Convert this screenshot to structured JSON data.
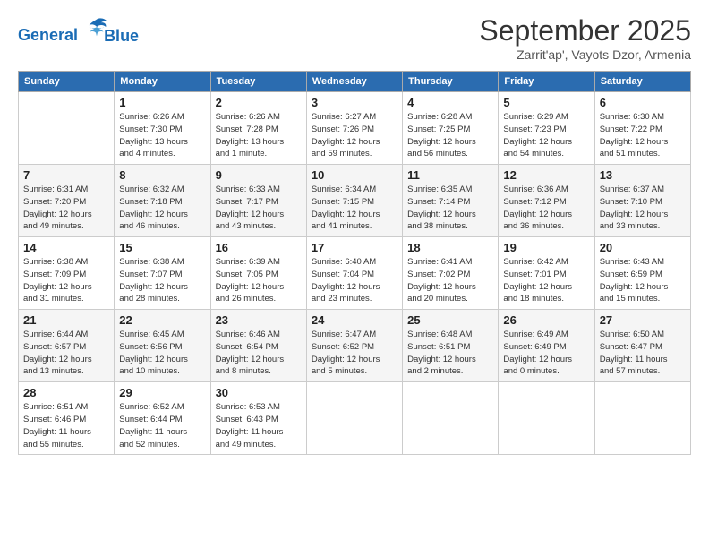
{
  "logo": {
    "line1": "General",
    "line2": "Blue"
  },
  "title": "September 2025",
  "subtitle": "Zarrit'ap', Vayots Dzor, Armenia",
  "days_of_week": [
    "Sunday",
    "Monday",
    "Tuesday",
    "Wednesday",
    "Thursday",
    "Friday",
    "Saturday"
  ],
  "weeks": [
    [
      {
        "day": "",
        "info": ""
      },
      {
        "day": "1",
        "info": "Sunrise: 6:26 AM\nSunset: 7:30 PM\nDaylight: 13 hours\nand 4 minutes."
      },
      {
        "day": "2",
        "info": "Sunrise: 6:26 AM\nSunset: 7:28 PM\nDaylight: 13 hours\nand 1 minute."
      },
      {
        "day": "3",
        "info": "Sunrise: 6:27 AM\nSunset: 7:26 PM\nDaylight: 12 hours\nand 59 minutes."
      },
      {
        "day": "4",
        "info": "Sunrise: 6:28 AM\nSunset: 7:25 PM\nDaylight: 12 hours\nand 56 minutes."
      },
      {
        "day": "5",
        "info": "Sunrise: 6:29 AM\nSunset: 7:23 PM\nDaylight: 12 hours\nand 54 minutes."
      },
      {
        "day": "6",
        "info": "Sunrise: 6:30 AM\nSunset: 7:22 PM\nDaylight: 12 hours\nand 51 minutes."
      }
    ],
    [
      {
        "day": "7",
        "info": "Sunrise: 6:31 AM\nSunset: 7:20 PM\nDaylight: 12 hours\nand 49 minutes."
      },
      {
        "day": "8",
        "info": "Sunrise: 6:32 AM\nSunset: 7:18 PM\nDaylight: 12 hours\nand 46 minutes."
      },
      {
        "day": "9",
        "info": "Sunrise: 6:33 AM\nSunset: 7:17 PM\nDaylight: 12 hours\nand 43 minutes."
      },
      {
        "day": "10",
        "info": "Sunrise: 6:34 AM\nSunset: 7:15 PM\nDaylight: 12 hours\nand 41 minutes."
      },
      {
        "day": "11",
        "info": "Sunrise: 6:35 AM\nSunset: 7:14 PM\nDaylight: 12 hours\nand 38 minutes."
      },
      {
        "day": "12",
        "info": "Sunrise: 6:36 AM\nSunset: 7:12 PM\nDaylight: 12 hours\nand 36 minutes."
      },
      {
        "day": "13",
        "info": "Sunrise: 6:37 AM\nSunset: 7:10 PM\nDaylight: 12 hours\nand 33 minutes."
      }
    ],
    [
      {
        "day": "14",
        "info": "Sunrise: 6:38 AM\nSunset: 7:09 PM\nDaylight: 12 hours\nand 31 minutes."
      },
      {
        "day": "15",
        "info": "Sunrise: 6:38 AM\nSunset: 7:07 PM\nDaylight: 12 hours\nand 28 minutes."
      },
      {
        "day": "16",
        "info": "Sunrise: 6:39 AM\nSunset: 7:05 PM\nDaylight: 12 hours\nand 26 minutes."
      },
      {
        "day": "17",
        "info": "Sunrise: 6:40 AM\nSunset: 7:04 PM\nDaylight: 12 hours\nand 23 minutes."
      },
      {
        "day": "18",
        "info": "Sunrise: 6:41 AM\nSunset: 7:02 PM\nDaylight: 12 hours\nand 20 minutes."
      },
      {
        "day": "19",
        "info": "Sunrise: 6:42 AM\nSunset: 7:01 PM\nDaylight: 12 hours\nand 18 minutes."
      },
      {
        "day": "20",
        "info": "Sunrise: 6:43 AM\nSunset: 6:59 PM\nDaylight: 12 hours\nand 15 minutes."
      }
    ],
    [
      {
        "day": "21",
        "info": "Sunrise: 6:44 AM\nSunset: 6:57 PM\nDaylight: 12 hours\nand 13 minutes."
      },
      {
        "day": "22",
        "info": "Sunrise: 6:45 AM\nSunset: 6:56 PM\nDaylight: 12 hours\nand 10 minutes."
      },
      {
        "day": "23",
        "info": "Sunrise: 6:46 AM\nSunset: 6:54 PM\nDaylight: 12 hours\nand 8 minutes."
      },
      {
        "day": "24",
        "info": "Sunrise: 6:47 AM\nSunset: 6:52 PM\nDaylight: 12 hours\nand 5 minutes."
      },
      {
        "day": "25",
        "info": "Sunrise: 6:48 AM\nSunset: 6:51 PM\nDaylight: 12 hours\nand 2 minutes."
      },
      {
        "day": "26",
        "info": "Sunrise: 6:49 AM\nSunset: 6:49 PM\nDaylight: 12 hours\nand 0 minutes."
      },
      {
        "day": "27",
        "info": "Sunrise: 6:50 AM\nSunset: 6:47 PM\nDaylight: 11 hours\nand 57 minutes."
      }
    ],
    [
      {
        "day": "28",
        "info": "Sunrise: 6:51 AM\nSunset: 6:46 PM\nDaylight: 11 hours\nand 55 minutes."
      },
      {
        "day": "29",
        "info": "Sunrise: 6:52 AM\nSunset: 6:44 PM\nDaylight: 11 hours\nand 52 minutes."
      },
      {
        "day": "30",
        "info": "Sunrise: 6:53 AM\nSunset: 6:43 PM\nDaylight: 11 hours\nand 49 minutes."
      },
      {
        "day": "",
        "info": ""
      },
      {
        "day": "",
        "info": ""
      },
      {
        "day": "",
        "info": ""
      },
      {
        "day": "",
        "info": ""
      }
    ]
  ]
}
